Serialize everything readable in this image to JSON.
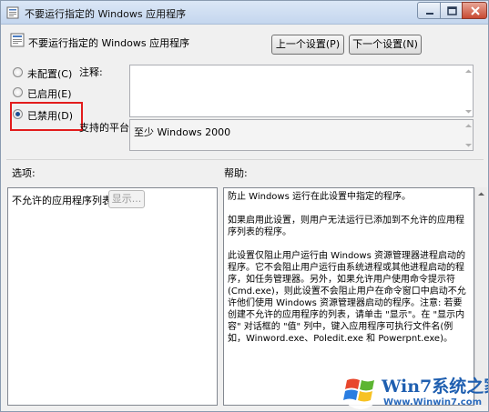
{
  "window": {
    "title": "不要运行指定的 Windows 应用程序"
  },
  "header": {
    "policy_title": "不要运行指定的 Windows 应用程序",
    "prev_setting_label": "上一个设置(P)",
    "next_setting_label": "下一个设置(N)"
  },
  "state": {
    "options": [
      {
        "label": "未配置(C)",
        "checked": false
      },
      {
        "label": "已启用(E)",
        "checked": false
      },
      {
        "label": "已禁用(D)",
        "checked": true
      }
    ]
  },
  "fields": {
    "comment_label": "注释:",
    "comment_value": "",
    "platform_label": "支持的平台:",
    "platform_value": "至少 Windows 2000"
  },
  "sections": {
    "options_label": "选项:",
    "help_label": "帮助:"
  },
  "options_panel": {
    "item_label": "不允许的应用程序列表",
    "show_button_label": "显示..."
  },
  "help_panel": {
    "paragraphs": [
      "防止 Windows 运行在此设置中指定的程序。",
      "如果启用此设置，则用户无法运行已添加到不允许的应用程序列表的程序。",
      "此设置仅阻止用户运行由 Windows 资源管理器进程启动的程序。它不会阻止用户运行由系统进程或其他进程启动的程序，如任务管理器。另外，如果允许用户使用命令提示符(Cmd.exe)，则此设置不会阻止用户在命令窗口中启动不允许他们使用 Windows 资源管理器启动的程序。注意: 若要创建不允许的应用程序的列表，请单击 \"显示\"。在 \"显示内容\" 对话框的 \"值\" 列中，键入应用程序可执行文件名(例如，Winword.exe、Poledit.exe 和 Powerpnt.exe)。"
    ]
  },
  "watermark": {
    "brand": "Win7系统之家",
    "url": "Www.Winwin7.com"
  },
  "colors": {
    "highlight": "#e21c1c",
    "brand": "#1f5fb0"
  },
  "icons": {
    "title": "policy-icon",
    "header": "policy-icon",
    "minimize": "minimize-icon",
    "maximize": "maximize-icon",
    "close": "close-icon",
    "watermark": "windows-logo-icon"
  }
}
